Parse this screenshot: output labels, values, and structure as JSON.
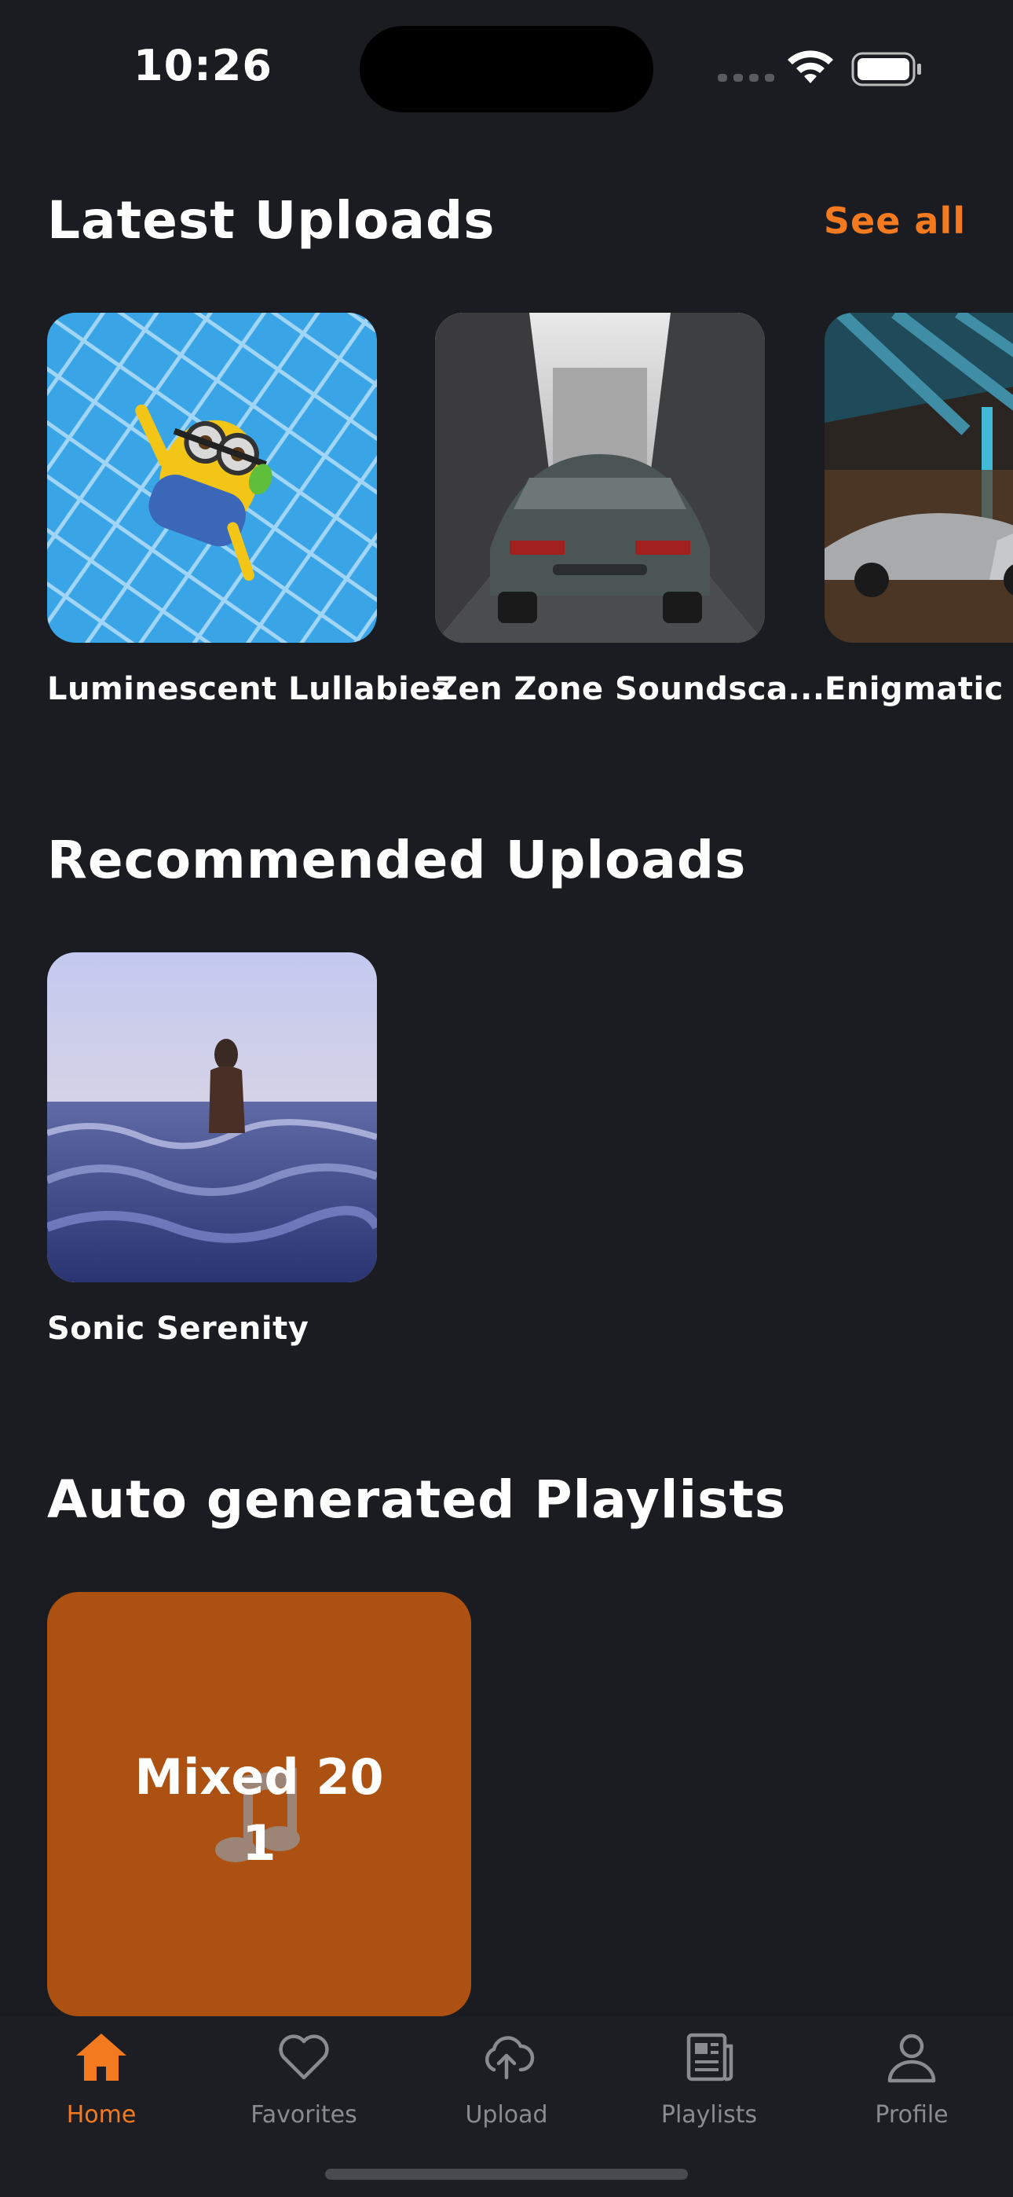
{
  "status_bar": {
    "time": "10:26"
  },
  "latest_uploads": {
    "title": "Latest Uploads",
    "see_all": "See all",
    "items": [
      {
        "title": "Luminescent Lullabies"
      },
      {
        "title": "Zen Zone Soundsca..."
      },
      {
        "title": "Enigmatic E"
      }
    ]
  },
  "recommended_uploads": {
    "title": "Recommended Uploads",
    "items": [
      {
        "title": "Sonic Serenity"
      }
    ]
  },
  "auto_playlists": {
    "title": "Auto generated Playlists",
    "items": [
      {
        "title": "Mixed 20\n1",
        "icon": "music-note-icon",
        "color": "#ad5112"
      }
    ]
  },
  "tab_bar": {
    "tabs": [
      {
        "label": "Home",
        "icon": "home-icon",
        "active": true
      },
      {
        "label": "Favorites",
        "icon": "heart-icon",
        "active": false
      },
      {
        "label": "Upload",
        "icon": "cloud-upload-icon",
        "active": false
      },
      {
        "label": "Playlists",
        "icon": "playlists-icon",
        "active": false
      },
      {
        "label": "Profile",
        "icon": "profile-icon",
        "active": false
      }
    ]
  },
  "colors": {
    "background": "#1b1c21",
    "accent": "#f47a1f",
    "inactive": "#8a8b90",
    "playlist_card": "#ad5112"
  }
}
